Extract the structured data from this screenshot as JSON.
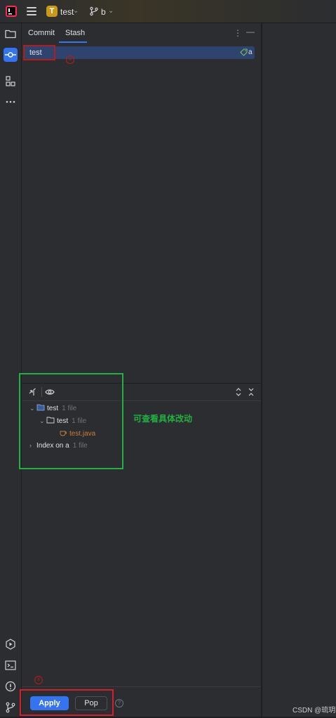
{
  "header": {
    "project_initial": "T",
    "project_name": "test",
    "branch_name": "b"
  },
  "tabs": {
    "commit": "Commit",
    "stash": "Stash"
  },
  "stash_list": {
    "items": [
      {
        "label": "test",
        "tag": "a",
        "selected": true
      }
    ]
  },
  "changes_tree": {
    "rows": [
      {
        "label": "test",
        "count": "1 file"
      },
      {
        "label": "test",
        "count": "1 file"
      },
      {
        "label": "test.java"
      },
      {
        "label": "Index on a",
        "count": "1 file"
      }
    ]
  },
  "annotations": {
    "marker1": "①",
    "marker2": "②",
    "note": "可查看具体改动"
  },
  "actions": {
    "apply": "Apply",
    "pop": "Pop",
    "help": "?"
  },
  "watermark": "CSDN @琉玥",
  "colors": {
    "accent": "#3574f0",
    "selection": "#2e436e",
    "annotation_red": "#d4202a",
    "annotation_green": "#22b041",
    "project_badge": "#c79a1c"
  }
}
